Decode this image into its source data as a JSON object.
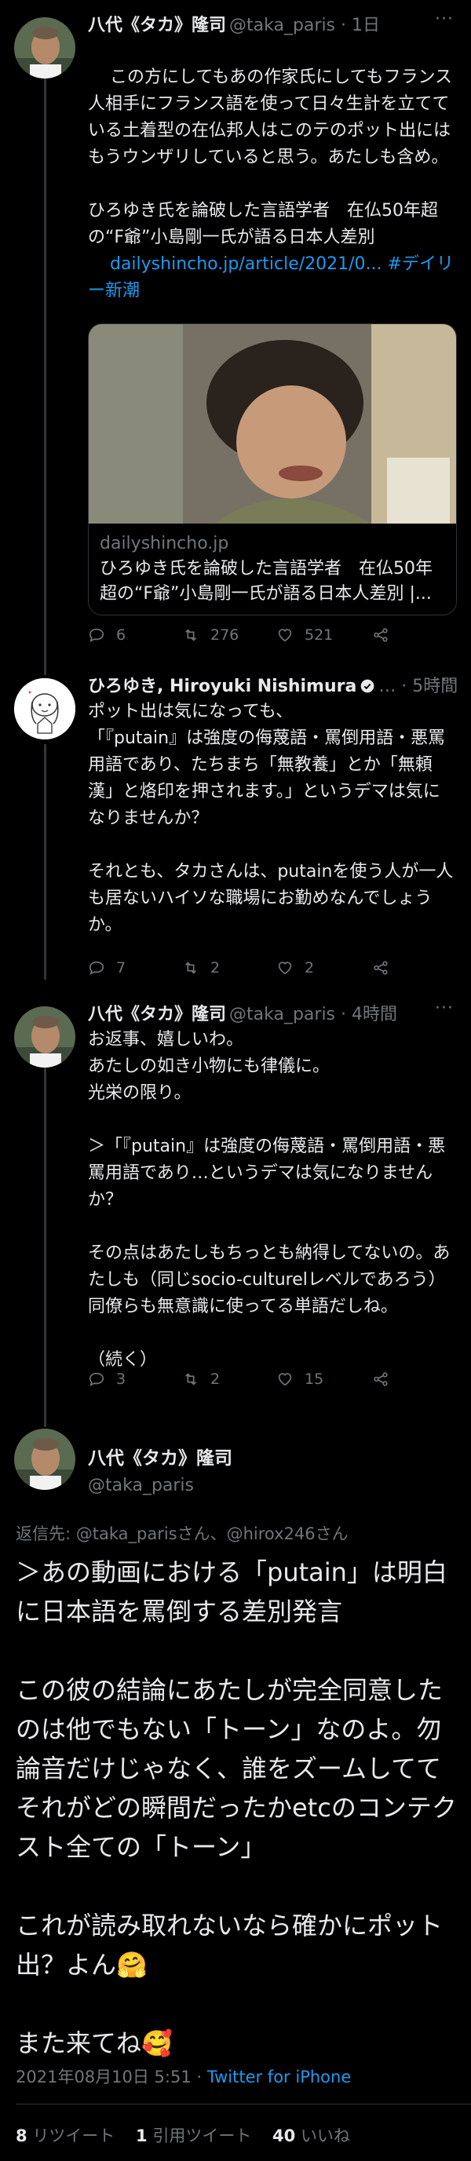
{
  "tweets": [
    {
      "name": "八代《タカ》隆司",
      "handle_time": "@taka_paris · 1日",
      "more": "···",
      "body": "この方にしてもあの作家氏にしてもフランス人相手にフランス語を使って日々生計を立てている土着型の在仏邦人はこのテのポット出にはもうウンザリしていると思う。あたしも含め。\n\nひろゆき氏を論破した言語学者　在仏50年超の“F爺”小島剛一氏が語る日本人差別",
      "link": "dailyshincho.jp/article/2021/0... #デイリー新潮",
      "card": {
        "domain": "dailyshincho.jp",
        "title": "ひろゆき氏を論破した言語学者　在仏50年超の“F爺”小島剛一氏が語る日本人差別 |..."
      },
      "replies": "6",
      "retweets": "276",
      "likes": "521"
    },
    {
      "name": "ひろゆき, Hiroyuki Nishimura",
      "handle_time": "… · 5時間",
      "more": "···",
      "body": "ポット出は気になっても、\n「『putain』は強度の侮蔑語・罵倒用語・悪罵用語であり、たちまち「無教養」とか「無頼漢」と烙印を押されます。」というデマは気になりませんか？\n\nそれとも、タカさんは、putainを使う人が一人も居ないハイソな職場にお勤めなんでしょうか。",
      "replies": "7",
      "retweets": "2",
      "likes": "2"
    },
    {
      "name": "八代《タカ》隆司",
      "handle_time": "@taka_paris · 4時間",
      "more": "···",
      "body": "お返事、嬉しいわ。\nあたしの如き小物にも律儀に。\n光栄の限り。\n\n＞「『putain』は強度の侮蔑語・罵倒用語・悪罵用語であり…というデマは気になりませんか？\n\nその点はあたしもちっとも納得してないの。あたしも（同じsocio-culturelレベルであろう）同僚らも無意識に使ってる単語だしね。\n\n（続く）",
      "replies": "3",
      "retweets": "2",
      "likes": "15"
    }
  ],
  "focus": {
    "name": "八代《タカ》隆司",
    "handle": "@taka_paris",
    "replying": "返信先: @taka_parisさん、@hirox246さん",
    "body": "＞あの動画における「putain」は明白に日本語を罵倒する差別発言\n\nこの彼の結論にあたしが完全同意したのは他でもない「トーン」なのよ。勿論音だけじゃなく、誰をズームしててそれがどの瞬間だったかetcのコンテクスト全ての「トーン」\n\nこれが読み取れないなら確かにポット出？よん🤗\n\nまた来てね🥰",
    "time": "2021年08月10日 5:51 · ",
    "client": "Twitter for iPhone",
    "retweets": "8",
    "retweets_label": "リツイート",
    "quotes": "1",
    "quotes_label": "引用ツイート",
    "likes": "40",
    "likes_label": "いいね"
  },
  "colors": {
    "accent": "#1d9bf0",
    "muted": "#71767b",
    "background": "#000000"
  },
  "icons": [
    "reply-icon",
    "retweet-icon",
    "like-icon",
    "share-icon",
    "verified-badge-icon",
    "more-icon"
  ]
}
